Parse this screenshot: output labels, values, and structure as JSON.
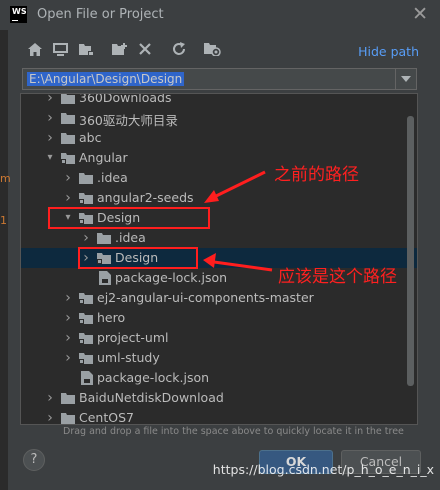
{
  "window": {
    "title": "Open File or Project",
    "app_logo": "WS"
  },
  "toolbar": {
    "icons": [
      "home-icon",
      "desktop-icon",
      "project-icon",
      "new-folder-icon",
      "delete-icon",
      "refresh-icon",
      "show-hidden-icon"
    ],
    "hide_path_label": "Hide path"
  },
  "path": {
    "value": "E:\\Angular\\Design\\Design"
  },
  "tree": {
    "rows": [
      {
        "label": "360Downloads",
        "type": "folder",
        "arrow": "collapsed"
      },
      {
        "label": "360驱动大师目录",
        "type": "folder",
        "arrow": "collapsed"
      },
      {
        "label": "abc",
        "type": "folder",
        "arrow": "collapsed"
      },
      {
        "label": "Angular",
        "type": "project",
        "arrow": "expanded"
      },
      {
        "label": ".idea",
        "type": "folder",
        "arrow": "collapsed"
      },
      {
        "label": "angular2-seeds",
        "type": "project",
        "arrow": "collapsed"
      },
      {
        "label": "Design",
        "type": "project",
        "arrow": "expanded"
      },
      {
        "label": ".idea",
        "type": "folder",
        "arrow": "collapsed"
      },
      {
        "label": "Design",
        "type": "project",
        "arrow": "collapsed",
        "selected": true
      },
      {
        "label": "package-lock.json",
        "type": "file",
        "arrow": "none"
      },
      {
        "label": "ej2-angular-ui-components-master",
        "type": "project",
        "arrow": "collapsed"
      },
      {
        "label": "hero",
        "type": "project",
        "arrow": "collapsed"
      },
      {
        "label": "project-uml",
        "type": "project",
        "arrow": "collapsed"
      },
      {
        "label": "uml-study",
        "type": "project",
        "arrow": "collapsed"
      },
      {
        "label": "package-lock.json",
        "type": "file",
        "arrow": "none"
      },
      {
        "label": "BaiduNetdiskDownload",
        "type": "folder",
        "arrow": "collapsed"
      },
      {
        "label": "CentOS7",
        "type": "folder",
        "arrow": "collapsed"
      }
    ]
  },
  "hint": "Drag and drop a file into the space above to quickly locate it in the tree",
  "buttons": {
    "help": "?",
    "ok": "OK",
    "cancel": "Cancel"
  },
  "annotations": {
    "previous_path": "之前的路径",
    "should_be_path": "应该是这个路径",
    "color": "#ff1e1e"
  },
  "watermark": "https://blog.csdn.net/p_h_o_e_n_i_x",
  "colors": {
    "background": "#3c3f41",
    "tree_bg": "#2b2b2b",
    "selection": "#0d293e",
    "link": "#589df6",
    "ok_button": "#365880"
  }
}
